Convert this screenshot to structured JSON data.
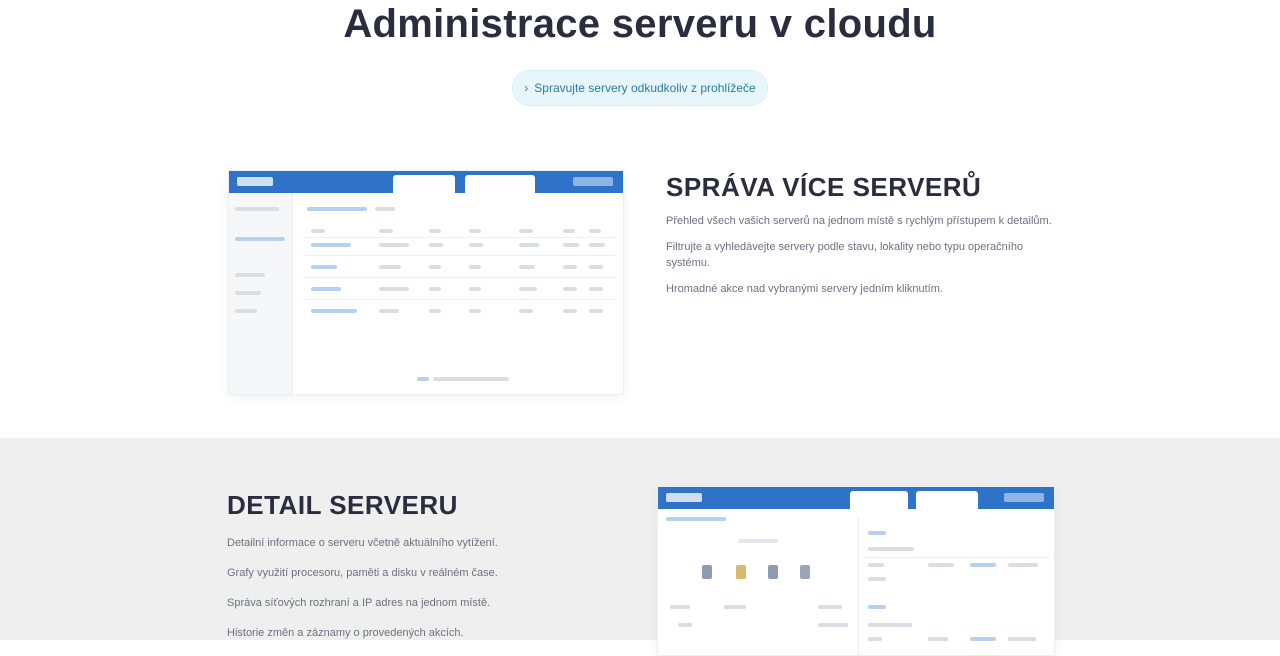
{
  "hero": {
    "title": "Administrace serveru v cloudu",
    "button_label": "Spravujte servery odkudkoliv z prohlížeče",
    "button_icon": "arrow-right-icon"
  },
  "section_overview": {
    "title": "SPRÁVA VÍCE SERVERŮ",
    "paragraphs": [
      "Přehled všech vašich serverů na jednom místě s rychlým přístupem k detailům.",
      "Filtrujte a vyhledávejte servery podle stavu, lokality nebo typu operačního systému.",
      "Hromadné akce nad vybranými servery jedním kliknutím."
    ]
  },
  "section_detail": {
    "title": "DETAIL SERVERU",
    "paragraphs": [
      "Detailní informace o serveru včetně aktuálního vytížení.",
      "Grafy využití procesoru, paměti a disku v reálném čase.",
      "Správa síťových rozhraní a IP adres na jednom místě.",
      "Historie změn a záznamy o provedených akcích."
    ]
  },
  "colors": {
    "brand_blue": "#2f73c8",
    "accent_light": "#e6f6fb",
    "section_bg": "#efefef"
  }
}
